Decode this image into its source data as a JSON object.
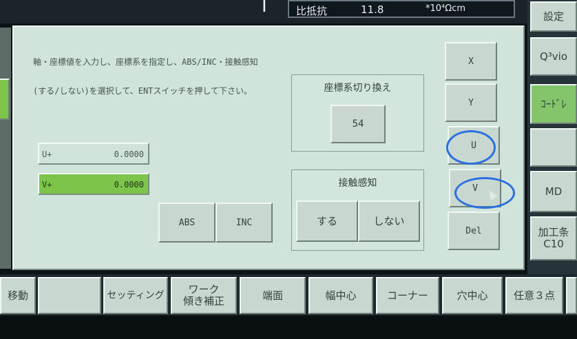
{
  "top_display": {
    "title_fragment": "I",
    "resistivity_label": "比抵抗",
    "resistivity_value": "11.8",
    "resistivity_unit": "*10⁴Ωcm"
  },
  "instruction": {
    "line1": "軸・座標値を入力し、座標系を指定し、ABS/INC・接触感知",
    "line2": "(する/しない)を選択して、ENTスイッチを押して下さい。"
  },
  "fields": [
    {
      "label": "U+",
      "value": "0.0000"
    },
    {
      "label": "V+",
      "value": "0.0000"
    }
  ],
  "coord_switch": {
    "title": "座標系切り換え",
    "value": "54"
  },
  "contact_sense": {
    "title": "接触感知",
    "on_label": "する",
    "off_label": "しない"
  },
  "mode_buttons": {
    "abs": "ABS",
    "inc": "INC"
  },
  "axis_buttons": [
    "X",
    "Y",
    "U",
    "V",
    "Del"
  ],
  "right_buttons": [
    "設定",
    "Q³vio",
    "ｺｰﾄﾞﾚ",
    "",
    "MD",
    "加工条 C10"
  ],
  "bottom_buttons": [
    "移動",
    "",
    "セッティング",
    "ワーク\n傾き補正",
    "端面",
    "幅中心",
    "コーナー",
    "穴中心",
    "任意３点"
  ],
  "colors": {
    "panel": "#d0e4db",
    "active_field": "#7cc44a",
    "annotation_circle": "#2a6fe0"
  }
}
